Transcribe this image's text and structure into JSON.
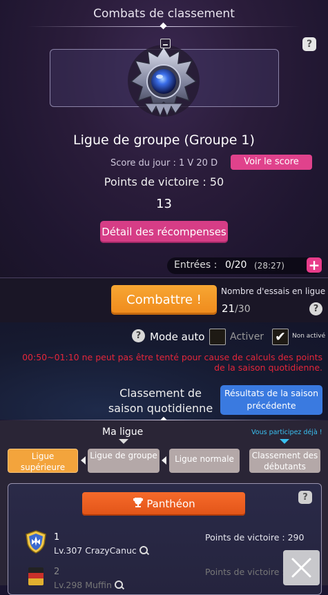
{
  "header": {
    "title": "Combats de classement"
  },
  "league": {
    "name": "Ligue de groupe (Groupe 1)",
    "score_day": "Score du jour : 1 V 20 D",
    "score_button": "Voir le score",
    "victory_points": "Points de victoire : 50",
    "rank": "13",
    "rewards_button": "Détail des récompenses"
  },
  "entries": {
    "label": "Entrées :",
    "value": "0/20",
    "timer": "(28:27)"
  },
  "battle": {
    "fight_button": "Combattre !",
    "attempts_label": "Nombre d'essais en ligue",
    "attempts_used": "21",
    "attempts_max": "/30"
  },
  "auto": {
    "label": "Mode auto",
    "activate": "Activer",
    "not_active": "Non activé",
    "warning": "00:50~01:10 ne peut pas être tenté pour cause de calculs des points de la saison quotidienne."
  },
  "season": {
    "daily_rank_label": "Classement de saison quotidienne",
    "prev_results_button": "Résultats de la saison précédente"
  },
  "leagues": {
    "my_league": "Ma ligue",
    "participating": "Vous participez déjà !",
    "items": [
      {
        "label": "Ligue supérieure"
      },
      {
        "label": "Ligue de groupe"
      },
      {
        "label": "Ligue normale"
      },
      {
        "label": "Classement des débutants"
      }
    ]
  },
  "pantheon": {
    "button": "Panthéon",
    "rows": [
      {
        "rank": "1",
        "player": "Lv.307 CrazyCanuc",
        "points": "Points de victoire : 290"
      },
      {
        "rank": "2",
        "player": "Lv.298 Muffin",
        "points": "Points de victoire :"
      }
    ]
  },
  "help_glyph": "?"
}
